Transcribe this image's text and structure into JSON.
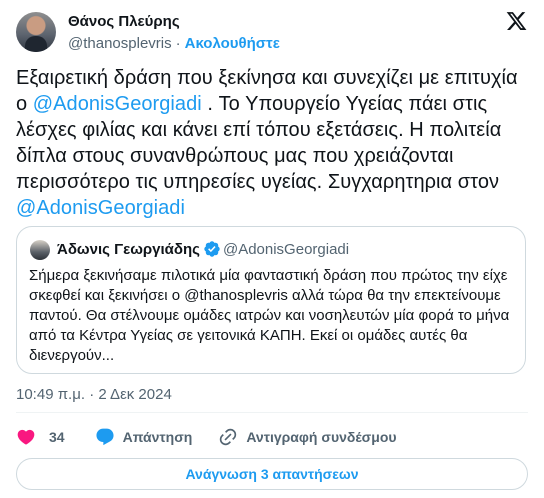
{
  "author": {
    "name": "Θάνος Πλεύρης",
    "handle": "@thanosplevris",
    "separator": "·",
    "follow_label": "Ακολουθήστε"
  },
  "tweet": {
    "text_part1": "Εξαιρετική δράση που ξεκίνησα και συνεχίζει με επιτυχία ο ",
    "mention1": "@AdonisGeorgiadi",
    "text_part2": " . Το Υπουργείο Υγείας πάει στις λέσχες φιλίας και κάνει επί τόπου εξετάσεις. Η πολιτεία δίπλα στους συνανθρώπους μας που χρειάζονται περισσότερο τις υπηρεσίες υγείας. Συγχαρητηρια στον ",
    "mention2": "@AdonisGeorgiadi"
  },
  "quote": {
    "name": "Άδωνις Γεωργιάδης",
    "handle": "@AdonisGeorgiadi",
    "text": "Σήμερα ξεκινήσαμε πιλοτικά μία φανταστική δράση που πρώτος την είχε σκεφθεί και ξεκινήσει ο @thanosplevris αλλά τώρα θα την επεκτείνουμε παντού. Θα στέλνουμε ομάδες ιατρών και νοσηλευτών μία φορά το μήνα από τα Κέντρα Υγείας σε γειτονικά ΚΑΠΗ. Εκεί οι ομάδες αυτές θα διενεργούν..."
  },
  "timestamp": "10:49 π.μ. · 2 Δεκ 2024",
  "actions": {
    "like_count": "34",
    "reply_label": "Απάντηση",
    "copy_link_label": "Αντιγραφή συνδέσμου"
  },
  "read_replies_label": "Ανάγνωση 3 απαντήσεων",
  "colors": {
    "accent": "#1d9bf0",
    "like": "#f91880",
    "secondary_text": "#536471",
    "border": "#cfd9de"
  },
  "icons": [
    "x-logo-icon",
    "verified-badge-icon",
    "heart-icon",
    "reply-icon",
    "link-icon"
  ]
}
